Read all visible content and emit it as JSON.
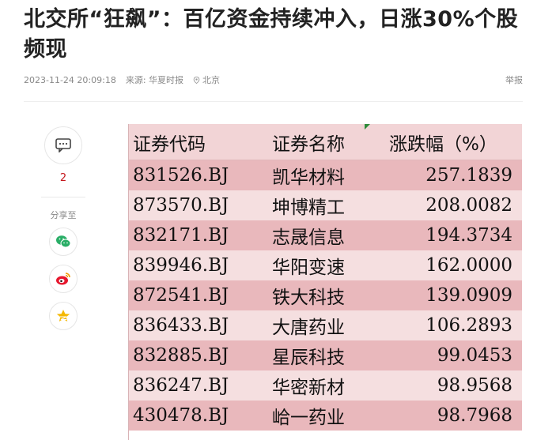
{
  "article": {
    "title": "北交所“狂飙”：百亿资金持续冲入，日涨30%个股频现",
    "datetime": "2023-11-24 20:09:18",
    "source": "来源: 华夏时报",
    "location": "北京",
    "report_label": "举报"
  },
  "rail": {
    "comment_icon": "comment-icon",
    "comment_count": "2",
    "share_label": "分享至",
    "share_items": [
      {
        "icon": "wechat-icon",
        "color": "#2aae67"
      },
      {
        "icon": "weibo-icon",
        "color": "#e6162d"
      },
      {
        "icon": "qzone-icon",
        "color": "#f5b800"
      }
    ]
  },
  "table": {
    "headers": [
      "证券代码",
      "证券名称",
      "涨跌幅（%）"
    ],
    "rows": [
      {
        "code": "831526.BJ",
        "name": "凯华材料",
        "pct": "257.1839"
      },
      {
        "code": "873570.BJ",
        "name": "坤博精工",
        "pct": "208.0082"
      },
      {
        "code": "832171.BJ",
        "name": "志晟信息",
        "pct": "194.3734"
      },
      {
        "code": "839946.BJ",
        "name": "华阳变速",
        "pct": "162.0000"
      },
      {
        "code": "872541.BJ",
        "name": "铁大科技",
        "pct": "139.0909"
      },
      {
        "code": "836433.BJ",
        "name": "大唐药业",
        "pct": "106.2893"
      },
      {
        "code": "832885.BJ",
        "name": "星辰科技",
        "pct": "99.0453"
      },
      {
        "code": "836247.BJ",
        "name": "华密新材",
        "pct": "98.9568"
      },
      {
        "code": "430478.BJ",
        "name": "峆一药业",
        "pct": "98.7968"
      }
    ]
  },
  "colors": {
    "odd_row": "#e9b8bc",
    "even_row": "#f5dfe0",
    "header_row": "#f2d4d6",
    "count_red": "#c4161c"
  }
}
